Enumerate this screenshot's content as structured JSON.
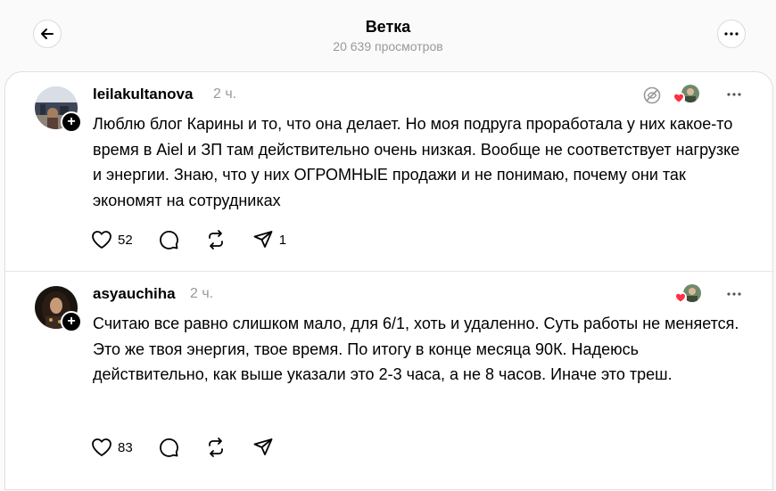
{
  "header": {
    "title": "Ветка",
    "views": "20 639 просмотров"
  },
  "posts": [
    {
      "username": "leilakultanova",
      "time": "2 ч.",
      "text": "Люблю блог Карины и то, что она делает. Но моя подруга проработала у них какое-то время в Aiel и ЗП там действительно очень низкая. Вообще не соответствует нагрузке и энергии. Знаю, что у них ОГРОМНЫЕ продажи и не понимаю, почему они так экономят на сотрудниках",
      "likes": "52",
      "comments": "",
      "reposts": "",
      "shares": "1"
    },
    {
      "username": "asyauchiha",
      "time": "2 ч.",
      "text": "Считаю все равно слишком мало, для 6/1, хоть и удаленно. Суть работы не меняется. Это же твоя энергия, твое время. По итогу в конце месяца 90К. Надеюсь действительно, как выше указали это 2-3 часа, а не 8 часов. Иначе это треш.",
      "likes": "83",
      "comments": "",
      "reposts": "",
      "shares": ""
    }
  ],
  "icons": {
    "back": "arrow-left-icon",
    "more": "ellipsis-icon",
    "like": "heart-icon",
    "comment": "speech-bubble-icon",
    "repost": "repost-icon",
    "share": "paper-plane-icon",
    "hidden": "eye-off-icon"
  },
  "colors": {
    "like_badge": "#ff3040",
    "secondary_text": "#999999"
  }
}
